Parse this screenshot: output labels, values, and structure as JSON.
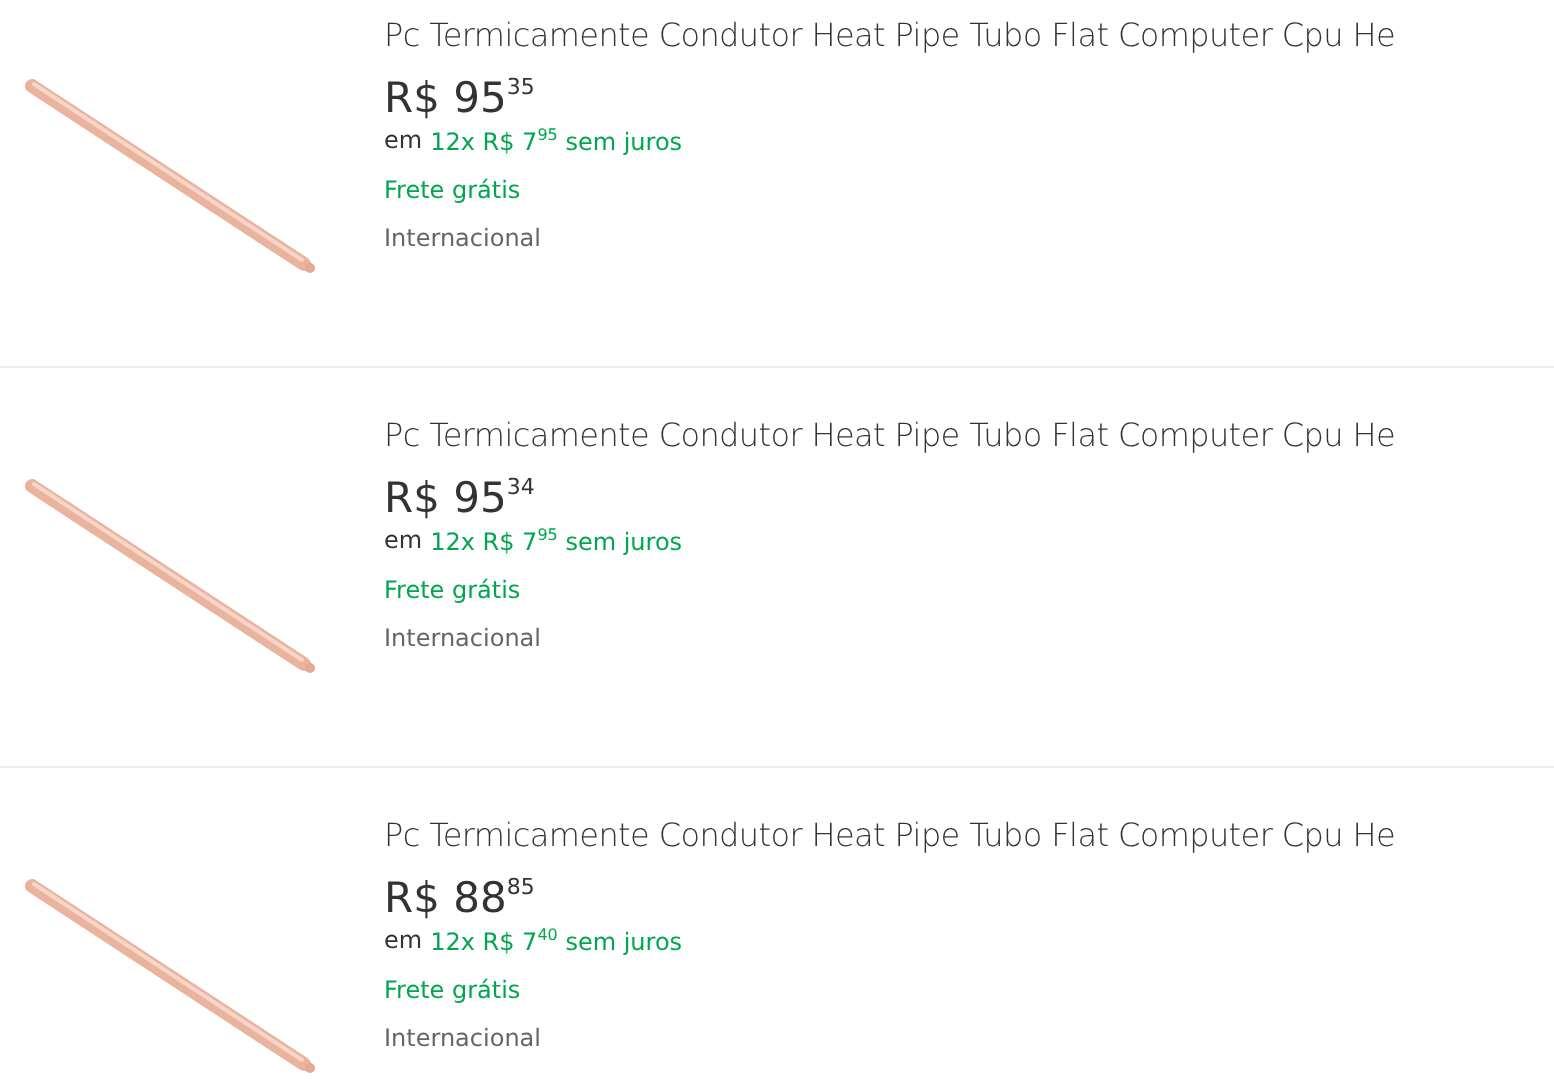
{
  "results": [
    {
      "title": "Pc Termicamente Condutor Heat Pipe Tubo Flat Computer Cpu He",
      "price": "R$ 95$^{35}$",
      "installment_prefix": "em",
      "installment": "12x R$ 7$^{95}$ sem juros",
      "shipping": "Frete grátis",
      "origin": "Internacional"
    },
    {
      "title": "Pc Termicamente Condutor Heat Pipe Tubo Flat Computer Cpu He",
      "price": "R$ 95$^{34}$",
      "installment_prefix": "em",
      "installment": "12x R$ 7$^{95}$ sem juros",
      "shipping": "Frete grátis",
      "origin": "Internacional"
    },
    {
      "title": "Pc Termicamente Condutor Heat Pipe Tubo Flat Computer Cpu He",
      "price": "R$ 88$^{85}$",
      "installment_prefix": "em",
      "installment": "12x R$ 7$^{40}$ sem juros",
      "shipping": "Frete grátis",
      "origin": "Internacional"
    }
  ]
}
